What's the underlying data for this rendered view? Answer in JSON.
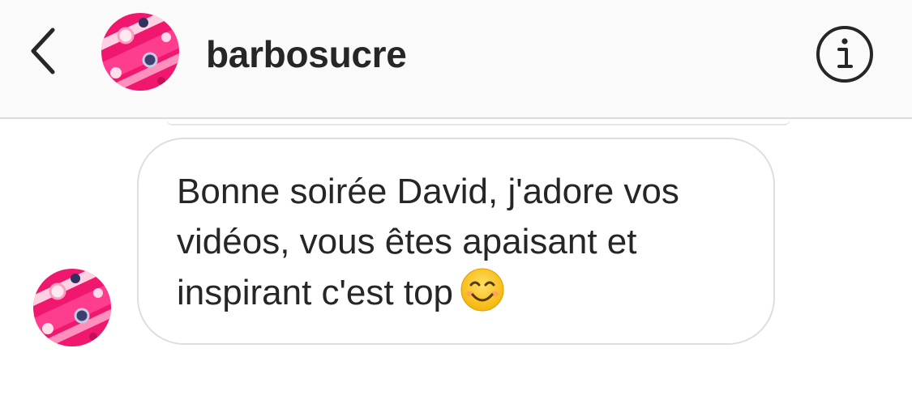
{
  "header": {
    "username": "barbosucre",
    "back_icon": "chevron-left-icon",
    "info_icon": "info-circle-icon"
  },
  "message": {
    "text": "Bonne soirée David, j'adore vos\nvidéos, vous êtes apaisant et\ninspirant c'est top",
    "emoji_icon": "smiling-face-icon"
  },
  "colors": {
    "header_bg": "#fafafa",
    "text": "#262626",
    "border": "#dbdbdb",
    "bubble_border": "#dedede"
  }
}
